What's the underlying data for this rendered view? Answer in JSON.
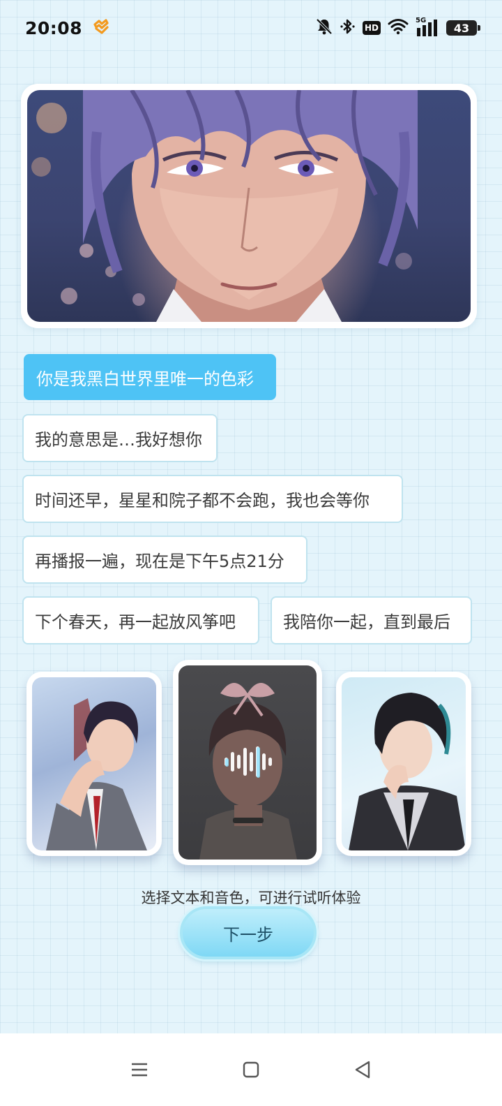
{
  "status_bar": {
    "time": "20:08",
    "hd_label": "HD",
    "network_label": "5G",
    "battery_level": "43",
    "icons": [
      "app-notification-icon",
      "mute-bell-icon",
      "bluetooth-icon",
      "hd-icon",
      "wifi-icon",
      "signal-icon",
      "battery-icon"
    ]
  },
  "phrases": [
    {
      "text": "你是我黑白世界里唯一的色彩",
      "selected": true
    },
    {
      "text": "我的意思是…我好想你",
      "selected": false
    },
    {
      "text": "时间还早，星星和院子都不会跑，我也会等你",
      "selected": false
    },
    {
      "text": "再播报一遍，现在是下午5点21分",
      "selected": false
    },
    {
      "text": "下个春天，再一起放风筝吧",
      "selected": false
    },
    {
      "text": "我陪你一起，直到最后",
      "selected": false
    }
  ],
  "voices": [
    {
      "name": "suit-man-voice",
      "selected": false
    },
    {
      "name": "bow-boy-voice",
      "selected": true,
      "playing": true
    },
    {
      "name": "tie-man-voice",
      "selected": false
    }
  ],
  "hint": "选择文本和音色，可进行试听体验",
  "next_button": "下一步",
  "colors": {
    "background": "#e4f4fb",
    "accent": "#4ec3f5",
    "border": "#bfe3ef"
  },
  "nav_bar": {
    "icons": [
      "menu-icon",
      "home-square-icon",
      "back-triangle-icon"
    ]
  }
}
